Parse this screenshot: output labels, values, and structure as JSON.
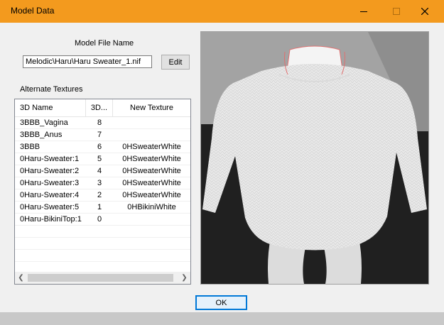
{
  "window": {
    "title": "Model Data"
  },
  "model_file": {
    "label": "Model File Name",
    "value": "Melodic\\Haru\\Haru Sweater_1.nif",
    "edit_label": "Edit"
  },
  "textures": {
    "label": "Alternate Textures",
    "columns": [
      "3D Name",
      "3D...",
      "New Texture"
    ],
    "rows": [
      {
        "name": "3BBB_Vagina",
        "index": "8",
        "texture": ""
      },
      {
        "name": "3BBB_Anus",
        "index": "7",
        "texture": ""
      },
      {
        "name": "3BBB",
        "index": "6",
        "texture": "0HSweaterWhite"
      },
      {
        "name": "0Haru-Sweater:1",
        "index": "5",
        "texture": "0HSweaterWhite"
      },
      {
        "name": "0Haru-Sweater:2",
        "index": "4",
        "texture": "0HSweaterWhite"
      },
      {
        "name": "0Haru-Sweater:3",
        "index": "3",
        "texture": "0HSweaterWhite"
      },
      {
        "name": "0Haru-Sweater:4",
        "index": "2",
        "texture": "0HSweaterWhite"
      },
      {
        "name": "0Haru-Sweater:5",
        "index": "1",
        "texture": "0HBikiniWhite"
      },
      {
        "name": "0Haru-BikiniTop:1",
        "index": "0",
        "texture": ""
      }
    ]
  },
  "ok_label": "OK",
  "colors": {
    "titlebar": "#f39a1e",
    "accent": "#0078d7"
  }
}
